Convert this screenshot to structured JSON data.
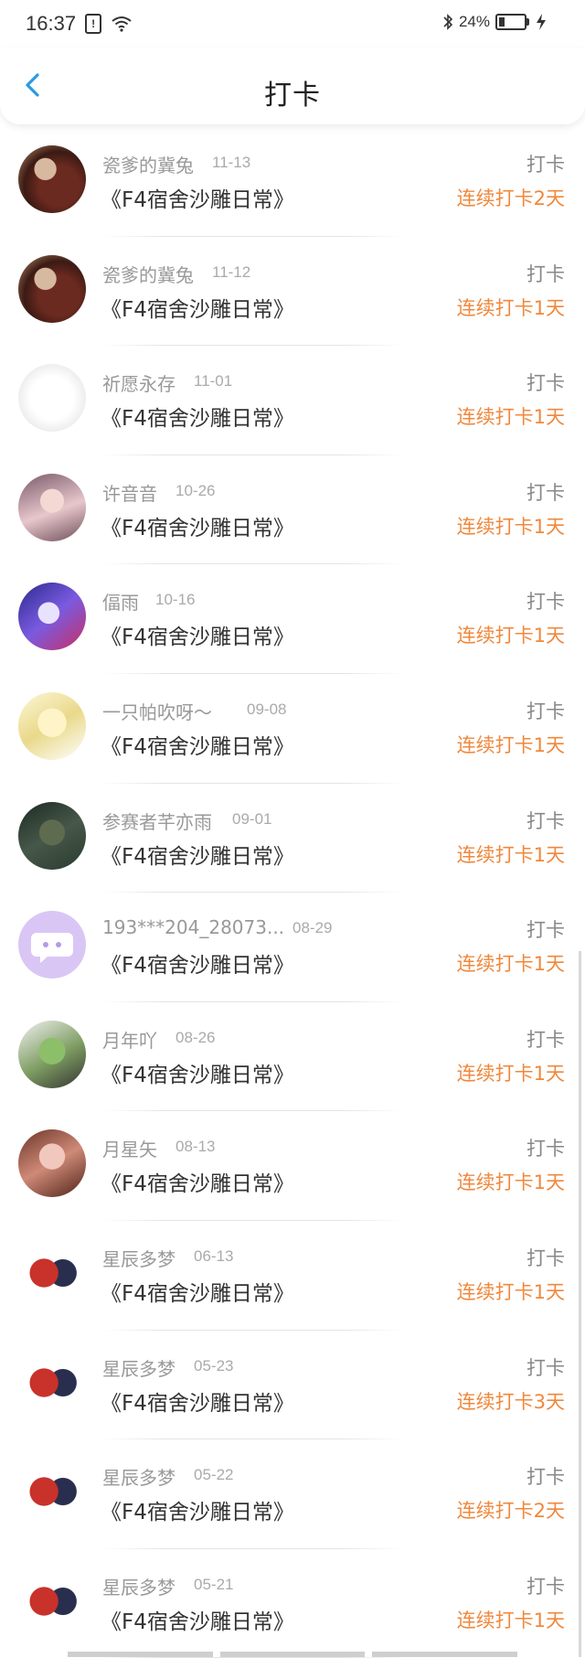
{
  "status_bar": {
    "time": "16:37",
    "battery_percent": "24%",
    "battery_level": 0.24,
    "icons": [
      "alert-box-icon",
      "wifi-icon",
      "bluetooth-icon",
      "battery-icon",
      "charging-bolt-icon"
    ]
  },
  "header": {
    "title": "打卡",
    "back_icon": "chevron-left-icon"
  },
  "colors": {
    "accent": "#2b9ae0",
    "streak": "#f0883c",
    "muted": "#999999"
  },
  "items": [
    {
      "user": "瓷爹的冀兔",
      "date": "11-13",
      "book": "《F4宿舍沙雕日常》",
      "checkin": "打卡",
      "streak": "连续打卡2天"
    },
    {
      "user": "瓷爹的冀兔",
      "date": "11-12",
      "book": "《F4宿舍沙雕日常》",
      "checkin": "打卡",
      "streak": "连续打卡1天"
    },
    {
      "user": "祈愿永存",
      "date": "11-01",
      "book": "《F4宿舍沙雕日常》",
      "checkin": "打卡",
      "streak": "连续打卡1天"
    },
    {
      "user": "许音音",
      "date": "10-26",
      "book": "《F4宿舍沙雕日常》",
      "checkin": "打卡",
      "streak": "连续打卡1天"
    },
    {
      "user": "偪雨",
      "date": "10-16",
      "book": "《F4宿舍沙雕日常》",
      "checkin": "打卡",
      "streak": "连续打卡1天"
    },
    {
      "user": "一只帕吹呀～",
      "date": "09-08",
      "book": "《F4宿舍沙雕日常》",
      "checkin": "打卡",
      "streak": "连续打卡1天"
    },
    {
      "user": "参赛者芊亦雨",
      "date": "09-01",
      "book": "《F4宿舍沙雕日常》",
      "checkin": "打卡",
      "streak": "连续打卡1天"
    },
    {
      "user": "193***204_28073...",
      "date": "08-29",
      "book": "《F4宿舍沙雕日常》",
      "checkin": "打卡",
      "streak": "连续打卡1天"
    },
    {
      "user": "月年吖",
      "date": "08-26",
      "book": "《F4宿舍沙雕日常》",
      "checkin": "打卡",
      "streak": "连续打卡1天"
    },
    {
      "user": "月星矢",
      "date": "08-13",
      "book": "《F4宿舍沙雕日常》",
      "checkin": "打卡",
      "streak": "连续打卡1天"
    },
    {
      "user": "星辰多梦",
      "date": "06-13",
      "book": "《F4宿舍沙雕日常》",
      "checkin": "打卡",
      "streak": "连续打卡1天"
    },
    {
      "user": "星辰多梦",
      "date": "05-23",
      "book": "《F4宿舍沙雕日常》",
      "checkin": "打卡",
      "streak": "连续打卡3天"
    },
    {
      "user": "星辰多梦",
      "date": "05-22",
      "book": "《F4宿舍沙雕日常》",
      "checkin": "打卡",
      "streak": "连续打卡2天"
    },
    {
      "user": "星辰多梦",
      "date": "05-21",
      "book": "《F4宿舍沙雕日常》",
      "checkin": "打卡",
      "streak": "连续打卡1天"
    }
  ]
}
